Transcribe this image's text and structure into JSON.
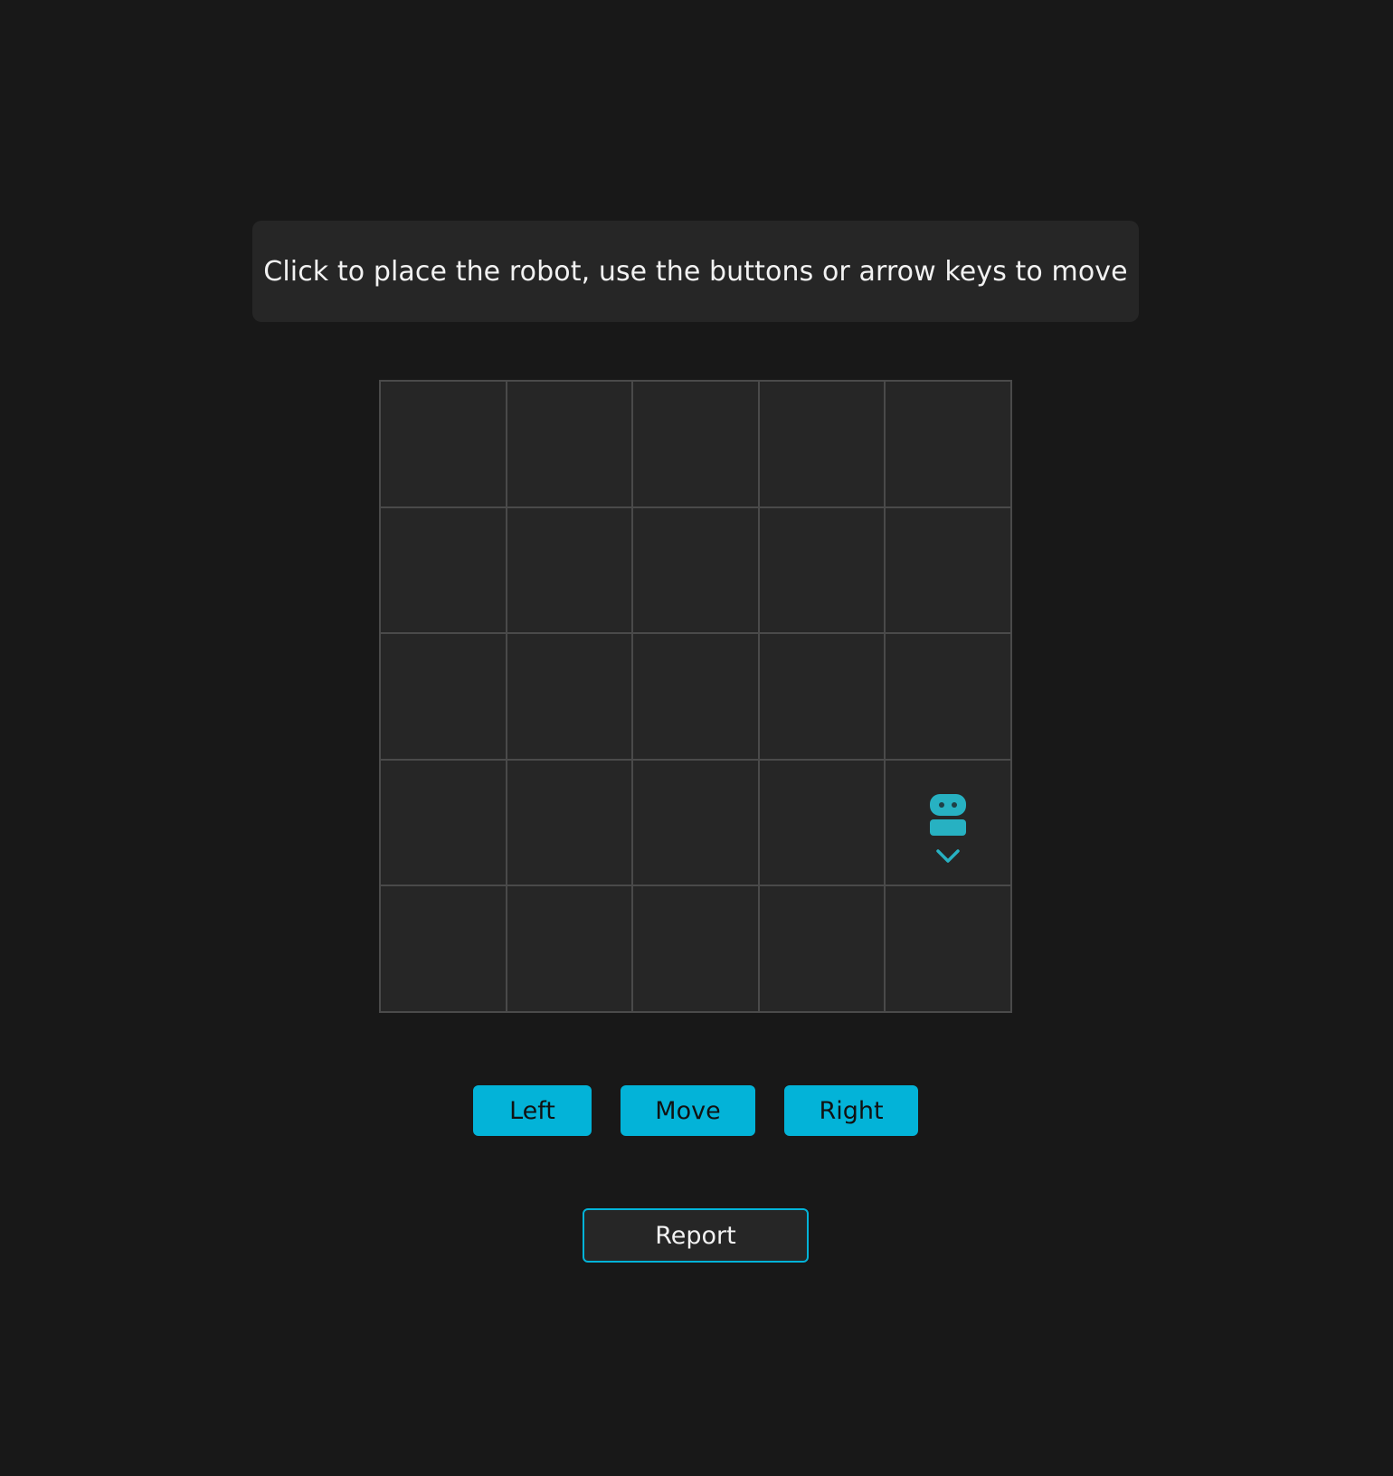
{
  "instructions": {
    "text": "Click to place the robot, use the buttons or arrow keys to move"
  },
  "board": {
    "rows": 5,
    "cols": 5,
    "robot": {
      "row": 4,
      "col": 5,
      "facing": "down",
      "icon": "robot-icon",
      "direction_icon": "chevron-down-icon",
      "color": "#27b1c2"
    }
  },
  "controls": {
    "left_label": "Left",
    "move_label": "Move",
    "right_label": "Right",
    "report_label": "Report",
    "accent": "#03b3d8"
  }
}
